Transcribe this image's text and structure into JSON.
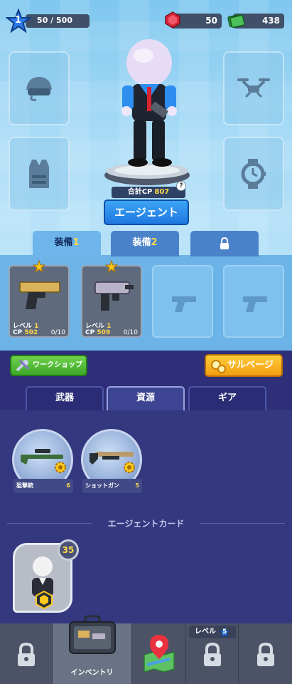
{
  "status": {
    "player_level": "1",
    "xp": "50 / 500",
    "gems": "50",
    "cash": "438",
    "level_icon": "star-icon",
    "gem_icon": "red-gem-icon",
    "cash_icon": "cash-stack-icon"
  },
  "equipment_slots": [
    {
      "name": "helmet",
      "icon": "helmet-icon"
    },
    {
      "name": "drone",
      "icon": "drone-icon"
    },
    {
      "name": "vest",
      "icon": "vest-icon"
    },
    {
      "name": "watch",
      "icon": "watch-icon"
    }
  ],
  "agent": {
    "total_cp_label": "合計CP",
    "total_cp_value": "807",
    "help": "?",
    "button_label": "エージェント"
  },
  "loadout_tabs": [
    {
      "label": "装備",
      "num": "1",
      "active": true
    },
    {
      "label": "装備",
      "num": "2",
      "active": false
    },
    {
      "label": "",
      "icon": "lock-icon",
      "active": false
    }
  ],
  "weapons": [
    {
      "level_label": "レベル",
      "level": "1",
      "cp_label": "CP",
      "cp": "502",
      "count": "0/10",
      "icon": "pistol-icon"
    },
    {
      "level_label": "レベル",
      "level": "1",
      "cp_label": "CP",
      "cp": "509",
      "count": "0/10",
      "icon": "smg-icon"
    }
  ],
  "buttons": {
    "workshop": "ワークショップ",
    "salvage": "サルベージ"
  },
  "category_tabs": [
    {
      "label": "武器",
      "active": false
    },
    {
      "label": "資源",
      "active": true
    },
    {
      "label": "ギア",
      "active": false
    }
  ],
  "resources": [
    {
      "name": "狙撃銃",
      "qty": "6",
      "icon": "sniper-rifle-icon"
    },
    {
      "name": "ショットガン",
      "qty": "5",
      "icon": "shotgun-icon"
    }
  ],
  "agent_cards": {
    "title": "エージェントカード",
    "count": "35"
  },
  "nav": {
    "inventory_label": "インベントリ",
    "level_label": "レベル",
    "level_req": "5"
  },
  "colors": {
    "accent_blue": "#1f78e0",
    "gold": "#ffd84a",
    "workshop_green": "#3da82a",
    "salvage_orange": "#f29d12"
  }
}
